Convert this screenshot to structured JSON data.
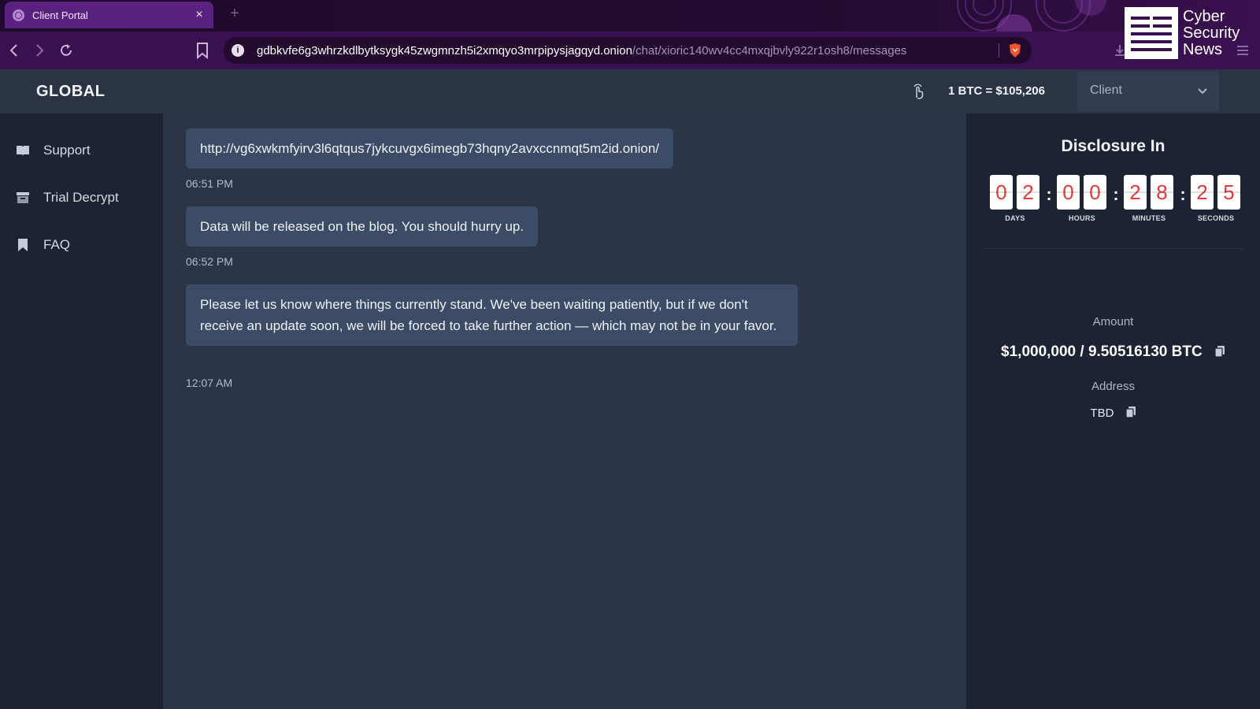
{
  "browser": {
    "tab_title": "Client Portal",
    "tab_close": "×",
    "new_tab": "+",
    "url_host": "gdbkvfe6g3whrzkdlbytksygk45zwgmnzh5i2xmqyo3mrpipysjagqyd.onion",
    "url_path": "/chat/xioric140wv4cc4mxqjbvly922r1osh8/messages",
    "icons": [
      "globe-icon",
      "back-icon",
      "forward-icon",
      "reload-icon",
      "bookmark-icon",
      "info-icon",
      "brave-shield-icon",
      "download-icon",
      "menu-icon"
    ]
  },
  "watermark": {
    "line1": "Cyber",
    "line2": "Security",
    "line3": "News"
  },
  "header": {
    "brand": "GLOBAL",
    "btc_rate": "1 BTC = $105,206",
    "role_selected": "Client"
  },
  "sidebar": {
    "items": [
      {
        "label": "Support",
        "icon": "book-open-icon"
      },
      {
        "label": "Trial Decrypt",
        "icon": "archive-icon"
      },
      {
        "label": "FAQ",
        "icon": "bookmark-icon"
      }
    ]
  },
  "chat": {
    "messages": [
      {
        "text": "http://vg6xwkmfyirv3l6qtqus7jykcuvgx6imegb73hqny2avxccnmqt5m2id.onion/",
        "time": "06:51 PM"
      },
      {
        "text": "Data will be released on the blog. You should hurry up.",
        "time": "06:52 PM"
      },
      {
        "text": "Please let us know where things currently stand. We've been waiting patiently, but if we don't receive an update soon, we will be forced to take further action — which may not be in your favor.",
        "time": "12:07 AM"
      }
    ]
  },
  "panel": {
    "title": "Disclosure In",
    "countdown": {
      "days": [
        "0",
        "2"
      ],
      "hours": [
        "0",
        "0"
      ],
      "minutes": [
        "2",
        "8"
      ],
      "seconds": [
        "2",
        "5"
      ],
      "labels": {
        "days": "DAYS",
        "hours": "HOURS",
        "minutes": "MINUTES",
        "seconds": "SECONDS"
      },
      "separator": ":"
    },
    "amount_label": "Amount",
    "amount_value": "$1,000,000 / 9.50516130 BTC",
    "address_label": "Address",
    "address_value": "TBD"
  },
  "colors": {
    "accent_purple": "#5b2181",
    "chat_bg": "#2c3547",
    "bubble": "#3d4c66",
    "countdown_digit": "#e23b3b"
  }
}
